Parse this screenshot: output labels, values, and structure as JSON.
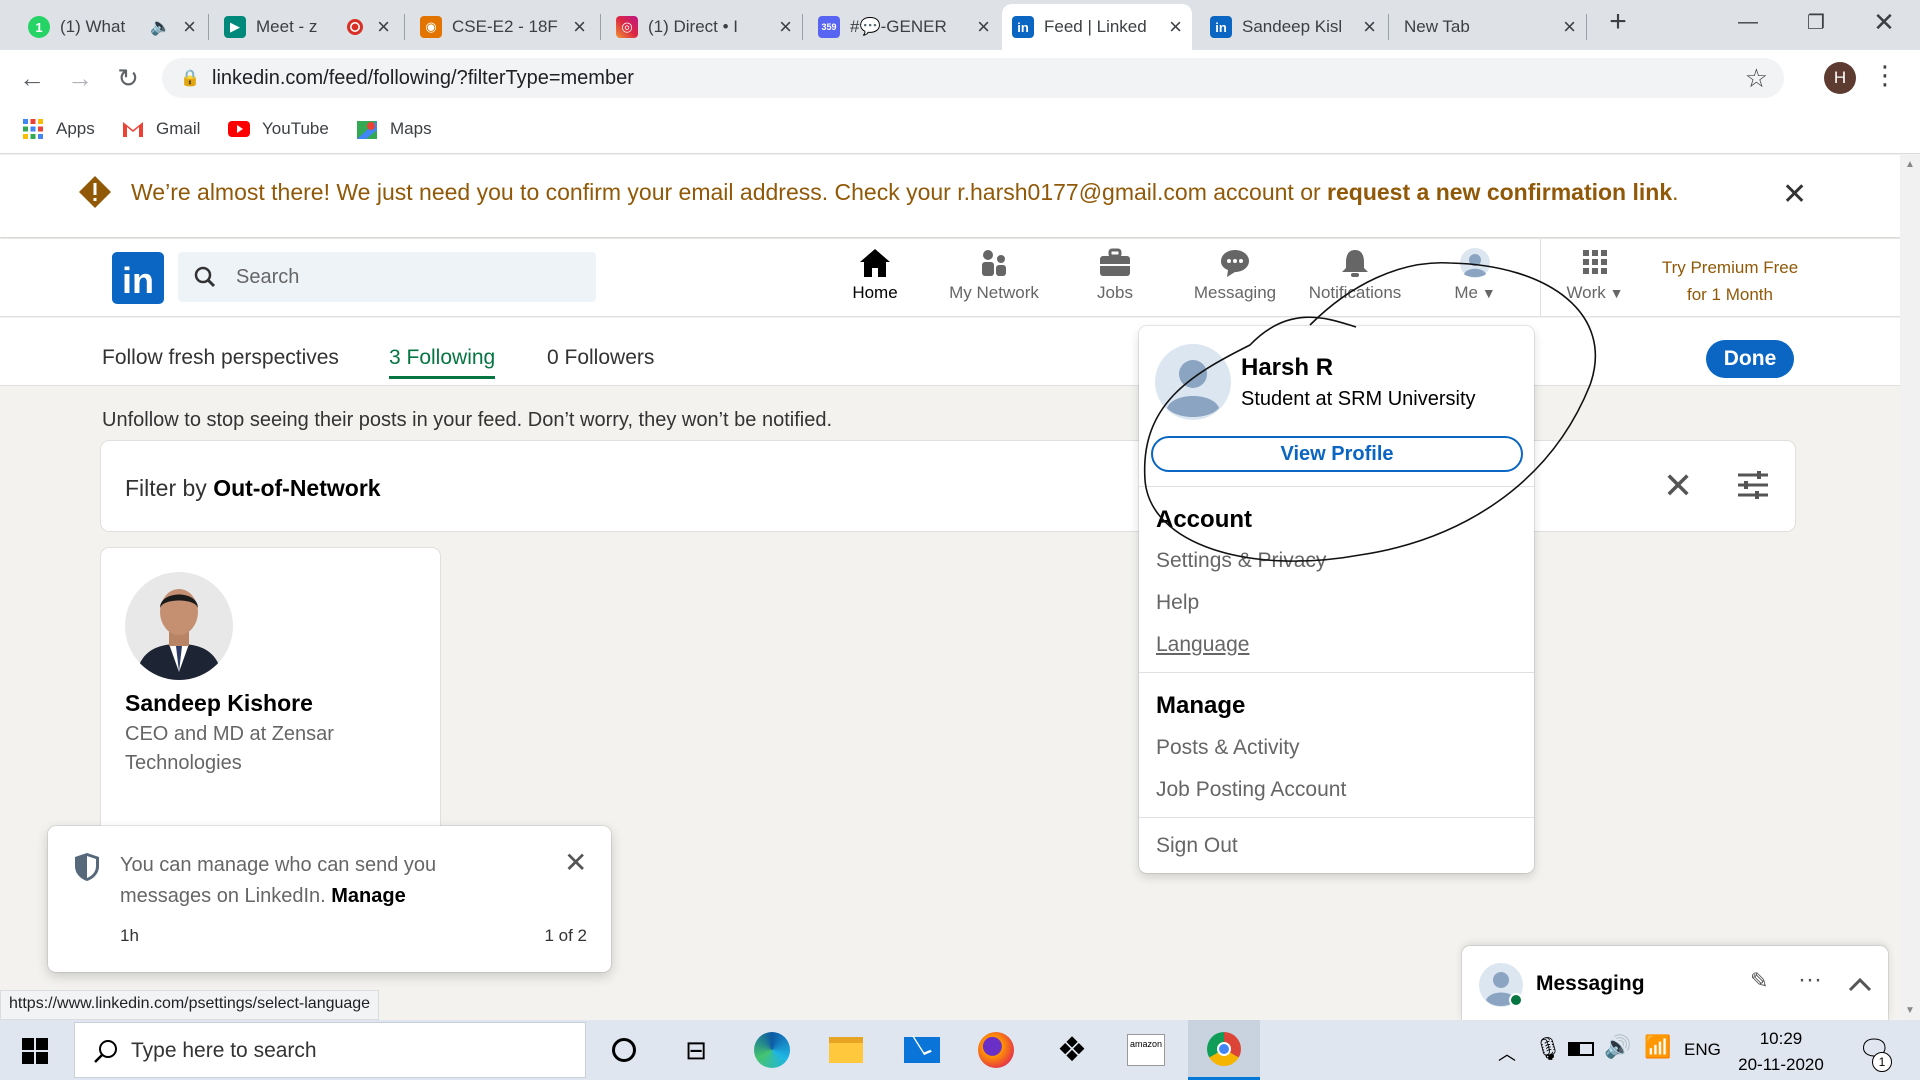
{
  "browser": {
    "tabs": [
      {
        "title": "(1) What",
        "favicon_color": "#25d366",
        "icon": "whatsapp-icon",
        "glyph": "1"
      },
      {
        "title": "Meet - z",
        "favicon_color": "#00897b",
        "icon": "meet-icon",
        "glyph": "▶"
      },
      {
        "title": "CSE-E2 - 18F",
        "favicon_color": "#e37400",
        "icon": "classroom-icon",
        "glyph": "◉"
      },
      {
        "title": "(1) Direct • I",
        "favicon_color": "#c13584",
        "icon": "instagram-icon",
        "glyph": "◎"
      },
      {
        "title": "#💬-GENER",
        "favicon_color": "#5865f2",
        "icon": "discord-icon",
        "glyph": "359"
      },
      {
        "title": "Feed | Linked",
        "favicon_color": "#0a66c2",
        "icon": "linkedin-icon",
        "glyph": "in"
      },
      {
        "title": "Sandeep Kisl",
        "favicon_color": "#0a66c2",
        "icon": "linkedin-icon",
        "glyph": "in"
      },
      {
        "title": "New Tab",
        "favicon_color": "",
        "icon": "",
        "glyph": ""
      }
    ],
    "url": "linkedin.com/feed/following/?filterType=member",
    "profile_initial": "H",
    "bookmarks": [
      {
        "label": "Apps",
        "icon": "apps-grid-icon"
      },
      {
        "label": "Gmail",
        "icon": "gmail-icon"
      },
      {
        "label": "YouTube",
        "icon": "youtube-icon"
      },
      {
        "label": "Maps",
        "icon": "maps-icon"
      }
    ],
    "status_url": "https://www.linkedin.com/psettings/select-language"
  },
  "banner": {
    "text": "We’re almost there! We just need you to confirm your email address. Check your r.harsh0177@gmail.com account or ",
    "link": "request a new confirmation link",
    "end": "."
  },
  "linkedin_nav": {
    "search_placeholder": "Search",
    "items": [
      {
        "label": "Home",
        "icon": "home-icon"
      },
      {
        "label": "My Network",
        "icon": "network-icon"
      },
      {
        "label": "Jobs",
        "icon": "briefcase-icon"
      },
      {
        "label": "Messaging",
        "icon": "chat-icon"
      },
      {
        "label": "Notifications",
        "icon": "bell-icon"
      },
      {
        "label": "Me",
        "icon": "avatar-icon"
      },
      {
        "label": "Work",
        "icon": "grid-icon"
      }
    ],
    "premium_line1": "Try Premium Free",
    "premium_line2": "for 1 Month"
  },
  "subnav": {
    "tabs": [
      "Follow fresh perspectives",
      "3 Following",
      "0 Followers"
    ],
    "done": "Done"
  },
  "content": {
    "hint": "Unfollow to stop seeing their posts in your feed. Don’t worry, they won’t be notified.",
    "filter_prefix": "Filter by ",
    "filter_value": "Out-of-Network",
    "person_name": "Sandeep Kishore",
    "person_headline": "CEO and MD at Zensar Technologies"
  },
  "dropdown": {
    "name": "Harsh R",
    "headline": "Student at SRM University",
    "view_profile": "View Profile",
    "account_heading": "Account",
    "account_items": [
      "Settings & Privacy",
      "Help",
      "Language"
    ],
    "manage_heading": "Manage",
    "manage_items": [
      "Posts & Activity",
      "Job Posting Account"
    ],
    "sign_out": "Sign Out"
  },
  "toast": {
    "text": "You can manage who can send you messages on LinkedIn.",
    "link": "Manage",
    "time": "1h",
    "pager": "1 of 2"
  },
  "messaging": {
    "label": "Messaging"
  },
  "taskbar": {
    "search_placeholder": "Type here to search",
    "language": "ENG",
    "time": "10:29",
    "date": "20-11-2020",
    "notification_count": "1"
  }
}
